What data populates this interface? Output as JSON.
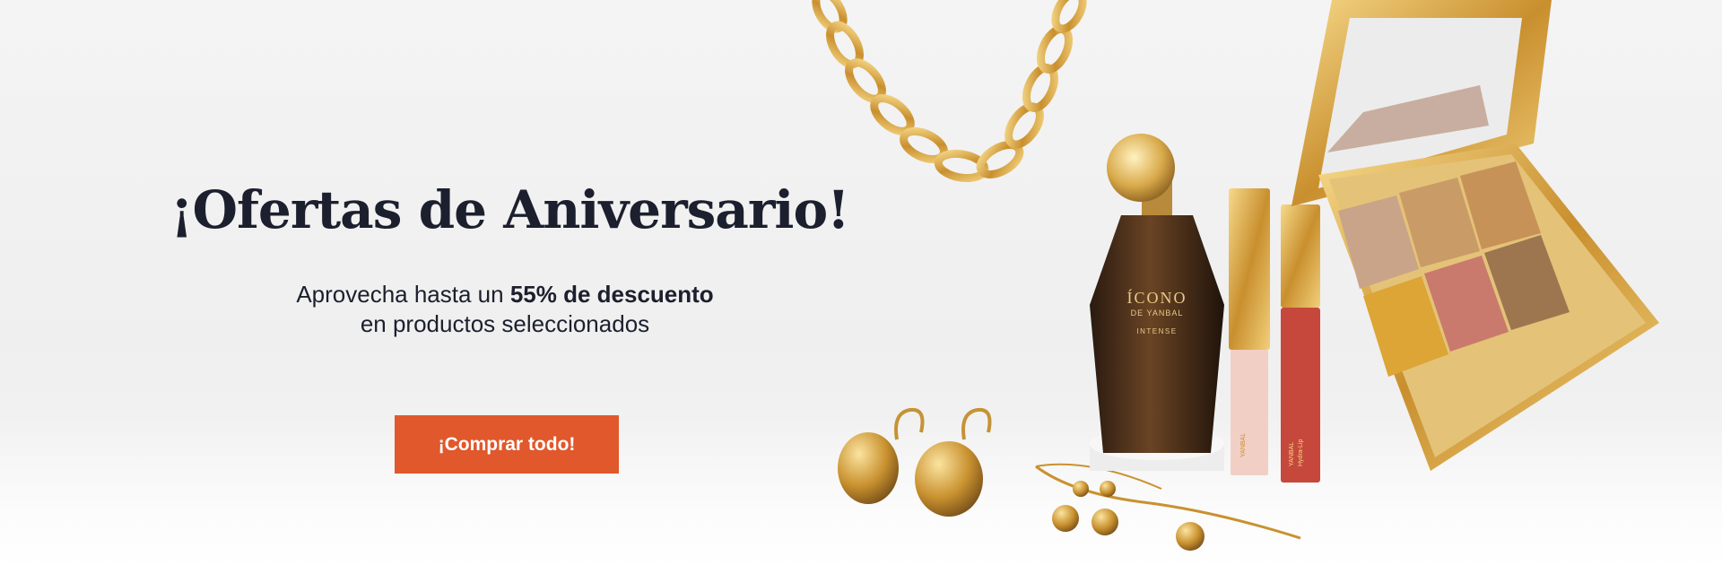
{
  "hero": {
    "title": "¡Ofertas de Aniversario!",
    "subtitle_prefix": "Aprovecha hasta un",
    "subtitle_emphasis": "55% de descuento",
    "subtitle_line2": "en productos seleccionados",
    "cta_label": "¡Comprar todo!"
  },
  "product_labels": {
    "perfume_name": "ÍCONO",
    "perfume_brand": "DE YANBAL",
    "perfume_variant": "INTENSE",
    "gloss_brand": "YANBAL",
    "gloss_name": "Hydra-Lip"
  },
  "colors": {
    "accent": "#e0582c",
    "title": "#1c1f2e",
    "gold": "#d4a040",
    "background": "#f1f1f1"
  },
  "icons": [
    "gold-chain-necklace-image",
    "gold-ball-earrings-image",
    "perfume-bottle-image",
    "lip-gloss-image",
    "eyeshadow-palette-image",
    "gold-bracelet-image"
  ]
}
